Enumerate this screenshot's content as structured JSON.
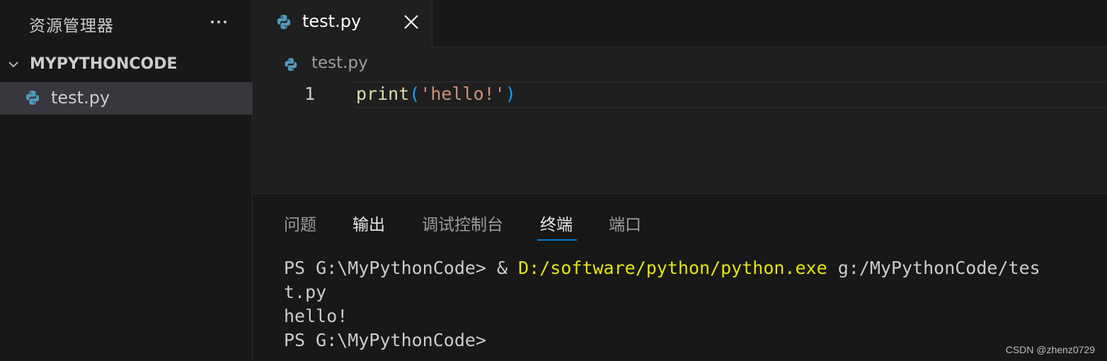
{
  "sidebar": {
    "title": "资源管理器",
    "more_icon": "ellipsis-icon",
    "section_label": "MYPYTHONCODE",
    "files": [
      {
        "label": "test.py",
        "icon": "python-file-icon"
      }
    ]
  },
  "editor": {
    "tab": {
      "label": "test.py",
      "icon": "python-file-icon",
      "close_icon": "close-icon"
    },
    "breadcrumb": {
      "label": "test.py"
    },
    "lines": [
      {
        "number": "1",
        "fn": "print",
        "open": "(",
        "str": "'hello!'",
        "close": ")"
      }
    ]
  },
  "panel": {
    "tabs": [
      "问题",
      "输出",
      "调试控制台",
      "终端",
      "端口"
    ],
    "active_tab": "终端",
    "terminal": {
      "line1_prompt": "PS G:\\MyPythonCode> ",
      "line1_amp": "& ",
      "line1_exe": "D:/software/python/python.exe",
      "line1_arg": " g:/MyPythonCode/tes",
      "line2": "t.py",
      "line3": "hello!",
      "line4": "PS G:\\MyPythonCode>"
    }
  },
  "colors": {
    "accent": "#0078d4",
    "python_icon": "#519aba",
    "string": "#ce9178",
    "function": "#dcdcaa",
    "terminal_yellow": "#e5e510"
  },
  "watermark": "CSDN @zhenz0729"
}
